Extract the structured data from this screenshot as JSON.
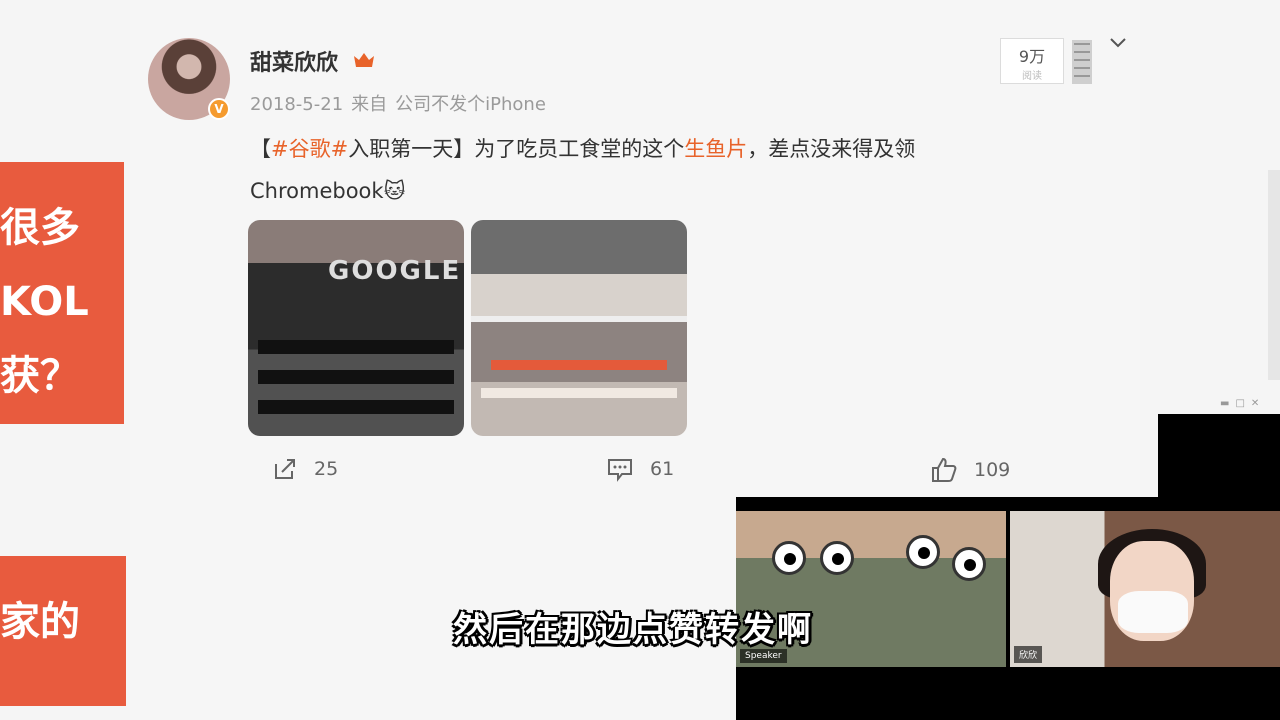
{
  "left_card_top": {
    "lines": [
      "很多",
      "KOL",
      "获？"
    ]
  },
  "left_card_bottom": {
    "lines": [
      "家的"
    ]
  },
  "post": {
    "username": "甜菜欣欣",
    "date": "2018-5-21",
    "source_prefix": "来自",
    "source": "公司不发个iPhone",
    "text_bracket_open": "【",
    "text_hashtag": "#谷歌#",
    "text_topic": "入职第一天",
    "text_bracket_close": "】",
    "text_body_a": "为了吃员工食堂的这个",
    "text_highlight": "生鱼片",
    "text_body_b": "，差点没来得及领",
    "text_line2": "Chromebook",
    "photo_1_sign": "GOOGLE",
    "follow_count": "9万",
    "follow_sub": "阅读"
  },
  "actions": {
    "share_count": "25",
    "comment_count": "61",
    "like_count": "109"
  },
  "video": {
    "tile_left_name": "Speaker",
    "tile_right_name": "欣欣"
  },
  "subtitle": "然后在那边点赞转发啊",
  "colors": {
    "accent": "#e8632a",
    "card_red": "#e85b3e",
    "badge": "#f59b2f"
  }
}
